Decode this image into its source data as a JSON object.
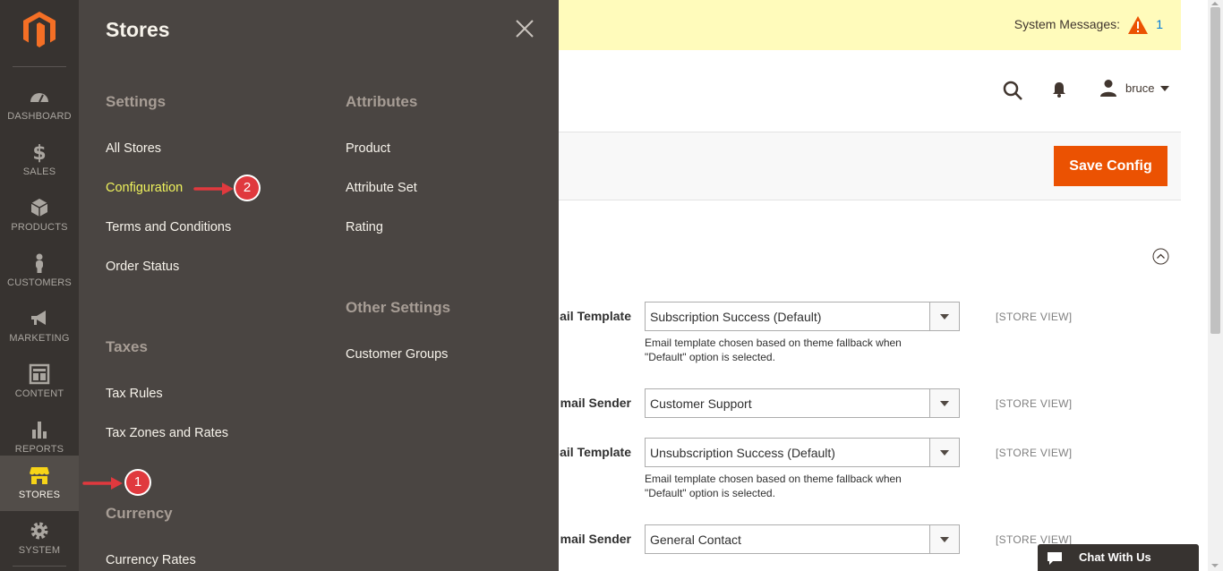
{
  "nav": {
    "items": [
      {
        "label": "DASHBOARD",
        "icon": "dashboard-icon"
      },
      {
        "label": "SALES",
        "icon": "dollar-icon"
      },
      {
        "label": "PRODUCTS",
        "icon": "cube-icon"
      },
      {
        "label": "CUSTOMERS",
        "icon": "person-icon"
      },
      {
        "label": "MARKETING",
        "icon": "megaphone-icon"
      },
      {
        "label": "CONTENT",
        "icon": "layout-icon"
      },
      {
        "label": "REPORTS",
        "icon": "bar-chart-icon"
      },
      {
        "label": "STORES",
        "icon": "store-icon",
        "active": true
      },
      {
        "label": "SYSTEM",
        "icon": "gear-icon"
      }
    ]
  },
  "panel": {
    "title": "Stores",
    "settings": {
      "heading": "Settings",
      "links": [
        "All Stores",
        "Configuration",
        "Terms and Conditions",
        "Order Status"
      ]
    },
    "taxes": {
      "heading": "Taxes",
      "links": [
        "Tax Rules",
        "Tax Zones and Rates"
      ]
    },
    "currency": {
      "heading": "Currency",
      "links": [
        "Currency Rates"
      ]
    },
    "attributes": {
      "heading": "Attributes",
      "links": [
        "Product",
        "Attribute Set",
        "Rating"
      ]
    },
    "other": {
      "heading": "Other Settings",
      "links": [
        "Customer Groups"
      ]
    }
  },
  "annotations": {
    "step1": "1",
    "step2": "2"
  },
  "header": {
    "system_messages_label": "System Messages:",
    "system_messages_count": "1",
    "user_name": "bruce"
  },
  "actions": {
    "save_label": "Save Config"
  },
  "form": {
    "fields": [
      {
        "label": "ail Template",
        "value": "Subscription Success (Default)",
        "note": "Email template chosen based on theme fallback when \"Default\" option is selected.",
        "scope": "[STORE VIEW]"
      },
      {
        "label": "mail Sender",
        "value": "Customer Support",
        "note": "",
        "scope": "[STORE VIEW]"
      },
      {
        "label": "ail Template",
        "value": "Unsubscription Success (Default)",
        "note": "Email template chosen based on theme fallback when \"Default\" option is selected.",
        "scope": "[STORE VIEW]"
      },
      {
        "label": "mail Sender",
        "value": "General Contact",
        "note": "",
        "scope": "[STORE VIEW]"
      }
    ]
  },
  "chat": {
    "label": "Chat With Us"
  },
  "colors": {
    "nav_bg": "#373330",
    "panel_bg": "#4a4542",
    "highlight": "#eef15c",
    "accent": "#eb5202",
    "badge": "#e0393e"
  }
}
